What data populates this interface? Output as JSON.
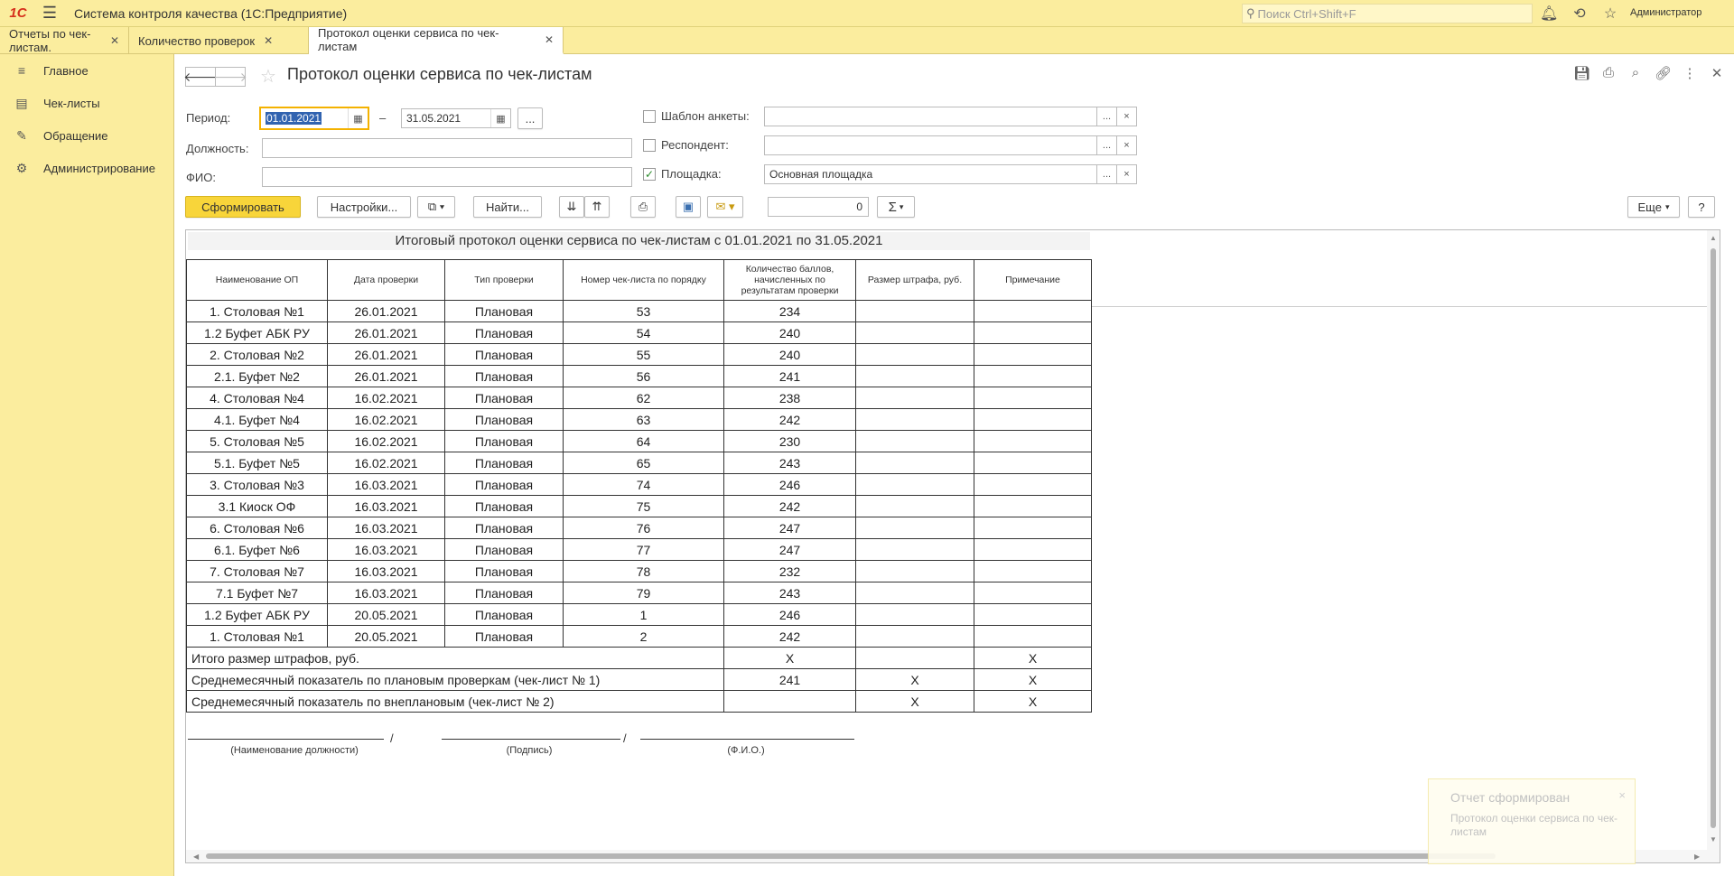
{
  "app": {
    "logo": "1С",
    "title": "Система контроля качества  (1С:Предприятие)",
    "search_placeholder": "Поиск Ctrl+Shift+F",
    "user": "Администратор"
  },
  "tabs": [
    {
      "label": "Отчеты по чек-листам."
    },
    {
      "label": "Количество проверок"
    },
    {
      "label": "Протокол оценки сервиса по чек-листам"
    }
  ],
  "sidebar": {
    "items": [
      {
        "label": "Главное",
        "icon": "menu-lines-icon"
      },
      {
        "label": "Чек-листы",
        "icon": "documents-icon"
      },
      {
        "label": "Обращение",
        "icon": "pencil-icon"
      },
      {
        "label": "Администрирование",
        "icon": "gear-icon"
      }
    ]
  },
  "form": {
    "title": "Протокол оценки сервиса по чек-листам",
    "period_label": "Период:",
    "date_from": "01.01.2021",
    "dash": "–",
    "date_to": "31.05.2021",
    "ellipsis": "...",
    "position_label": "Должность:",
    "position_value": "",
    "fio_label": "ФИО:",
    "fio_value": "",
    "template_label": "Шаблон анкеты:",
    "template_value": "",
    "respondent_label": "Респондент:",
    "respondent_value": "",
    "site_label": "Площадка:",
    "site_value": "Основная площадка",
    "site_checked": "✓",
    "clear": "×"
  },
  "toolbar": {
    "generate": "Сформировать",
    "settings": "Настройки...",
    "find": "Найти...",
    "sum_value": "0",
    "sigma": "Σ",
    "more": "Еще",
    "help": "?"
  },
  "report": {
    "title": "Итоговый протокол оценки сервиса по чек-листам с 01.01.2021 по 31.05.2021",
    "columns": [
      "Наименование ОП",
      "Дата проверки",
      "Тип проверки",
      "Номер чек-листа по порядку",
      "Количество баллов, начисленных по результатам проверки",
      "Размер штрафа, руб.",
      "Примечание"
    ],
    "rows": [
      [
        "1. Столовая №1",
        "26.01.2021",
        "Плановая",
        "53",
        "234",
        "",
        ""
      ],
      [
        "1.2 Буфет АБК РУ",
        "26.01.2021",
        "Плановая",
        "54",
        "240",
        "",
        ""
      ],
      [
        "2. Столовая №2",
        "26.01.2021",
        "Плановая",
        "55",
        "240",
        "",
        ""
      ],
      [
        "2.1. Буфет №2",
        "26.01.2021",
        "Плановая",
        "56",
        "241",
        "",
        ""
      ],
      [
        "4. Столовая №4",
        "16.02.2021",
        "Плановая",
        "62",
        "238",
        "",
        ""
      ],
      [
        "4.1. Буфет №4",
        "16.02.2021",
        "Плановая",
        "63",
        "242",
        "",
        ""
      ],
      [
        "5. Столовая №5",
        "16.02.2021",
        "Плановая",
        "64",
        "230",
        "",
        ""
      ],
      [
        "5.1. Буфет №5",
        "16.02.2021",
        "Плановая",
        "65",
        "243",
        "",
        ""
      ],
      [
        "3. Столовая №3",
        "16.03.2021",
        "Плановая",
        "74",
        "246",
        "",
        ""
      ],
      [
        "3.1 Киоск ОФ",
        "16.03.2021",
        "Плановая",
        "75",
        "242",
        "",
        ""
      ],
      [
        "6. Столовая №6",
        "16.03.2021",
        "Плановая",
        "76",
        "247",
        "",
        ""
      ],
      [
        "6.1. Буфет №6",
        "16.03.2021",
        "Плановая",
        "77",
        "247",
        "",
        ""
      ],
      [
        "7. Столовая №7",
        "16.03.2021",
        "Плановая",
        "78",
        "232",
        "",
        ""
      ],
      [
        "7.1 Буфет №7",
        "16.03.2021",
        "Плановая",
        "79",
        "243",
        "",
        ""
      ],
      [
        "1.2 Буфет АБК РУ",
        "20.05.2021",
        "Плановая",
        "1",
        "246",
        "",
        ""
      ],
      [
        "1. Столовая №1",
        "20.05.2021",
        "Плановая",
        "2",
        "242",
        "",
        ""
      ]
    ],
    "totals": [
      {
        "label": "Итого размер штрафов, руб.",
        "score": "X",
        "fine": "",
        "note": "X"
      },
      {
        "label": "Среднемесячный показатель по плановым проверкам (чек-лист № 1)",
        "score": "241",
        "fine": "X",
        "note": "X"
      },
      {
        "label": "Среднемесячный показатель по внеплановым (чек-лист № 2)",
        "score": "",
        "fine": "X",
        "note": "X"
      }
    ],
    "sig_slash": "/",
    "sig_position": "(Наименование должности)",
    "sig_sign": "(Подпись)",
    "sig_fio": "(Ф.И.О.)"
  },
  "notification": {
    "title": "Отчет сформирован",
    "text": "Протокол оценки сервиса по чек-листам",
    "close": "×"
  }
}
